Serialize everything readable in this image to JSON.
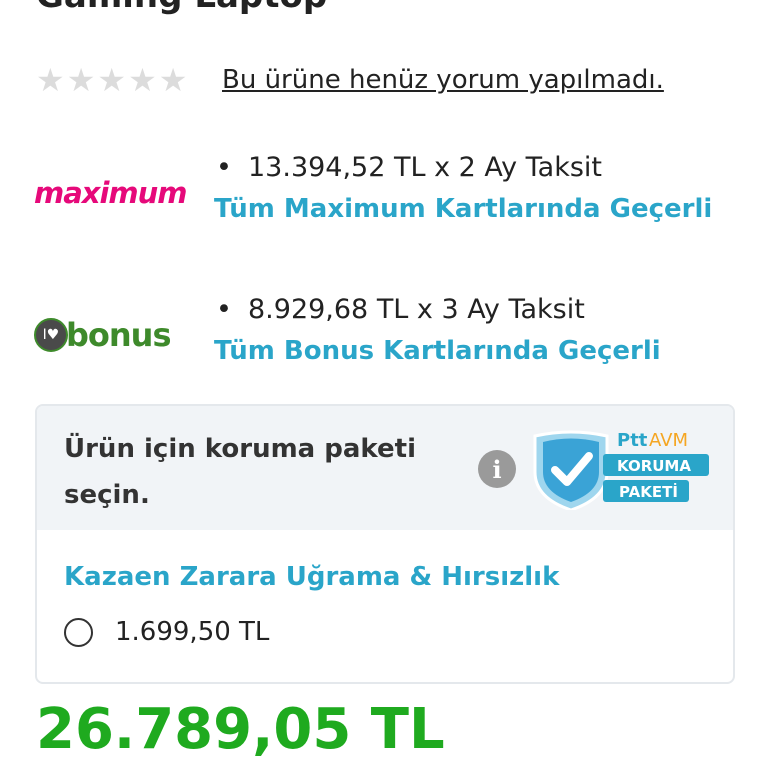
{
  "product": {
    "title": "Gaming Laptop",
    "rating": 0,
    "max_rating": 5,
    "review_text": "Bu ürüne henüz yorum yapılmadı."
  },
  "installments": [
    {
      "logo_name": "maximum-logo",
      "logo_text": "maximum",
      "offer": "13.394,52 TL x 2 Ay Taksit",
      "card_note": "Tüm Maximum Kartlarında Geçerli"
    },
    {
      "logo_name": "bonus-logo",
      "logo_text": "bonus",
      "offer": "8.929,68 TL x 3 Ay Taksit",
      "card_note": "Tüm Bonus Kartlarında Geçerli"
    }
  ],
  "protection": {
    "heading": "Ürün için koruma paketi seçin.",
    "badge": {
      "brand_ptt": "Ptt",
      "brand_avm": "AVM",
      "line1": "KORUMA",
      "line2": "PAKETİ"
    },
    "option_title": "Kazaen Zarara Uğrama & Hırsızlık",
    "option_price": "1.699,50 TL",
    "option_selected": false
  },
  "price": "26.789,05 TL",
  "colors": {
    "accent_blue": "#2aa5c9",
    "price_green": "#1faa1f",
    "maximum_pink": "#e6097a",
    "bonus_green": "#3e8a2b"
  }
}
